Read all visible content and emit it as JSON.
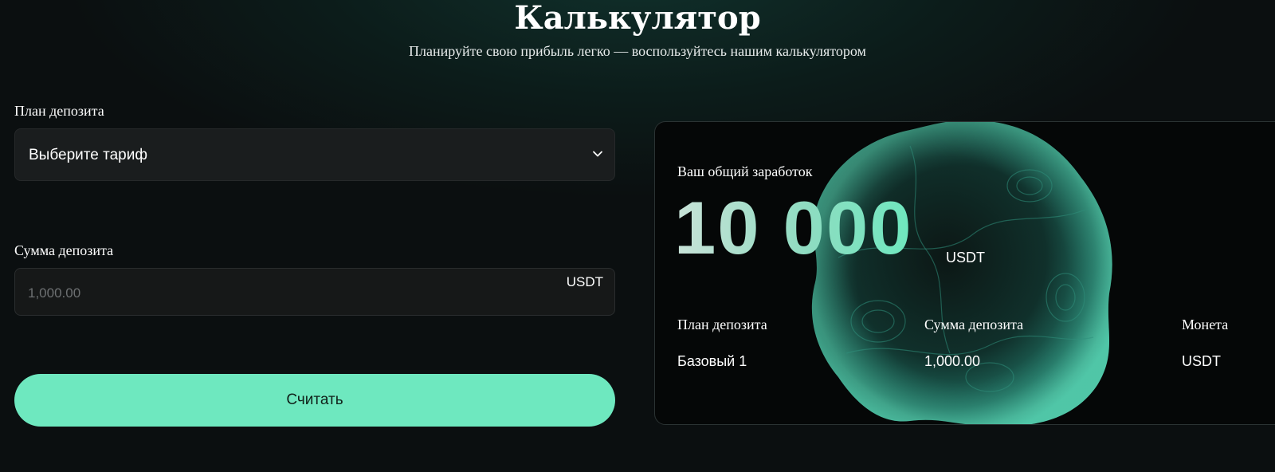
{
  "header": {
    "title": "Калькулятор",
    "subtitle": "Планируйте свою прибыль легко — воспользуйтесь нашим калькулятором"
  },
  "form": {
    "plan_label": "План депозита",
    "plan_select_value": "Выберите тариф",
    "amount_label": "Сумма депозита",
    "amount_placeholder": "1,000.00",
    "amount_unit": "USDT",
    "calculate_label": "Считать"
  },
  "result": {
    "total_label": "Ваш общий заработок",
    "total_value": "10 000",
    "total_unit": "USDT",
    "columns": [
      {
        "header": "План депозита",
        "value": "Базовый 1"
      },
      {
        "header": "Сумма депозита",
        "value": "1,000.00"
      },
      {
        "header": "Монета",
        "value": "USDT"
      }
    ]
  },
  "icons": {
    "select_arrow": "chevron-down-icon",
    "decoration": "abstract-sphere-graphic"
  },
  "colors": {
    "accent": "#6ee8bf",
    "background": "#0b0f10",
    "card_background": "#050707",
    "input_background": "#1a1d1e"
  }
}
